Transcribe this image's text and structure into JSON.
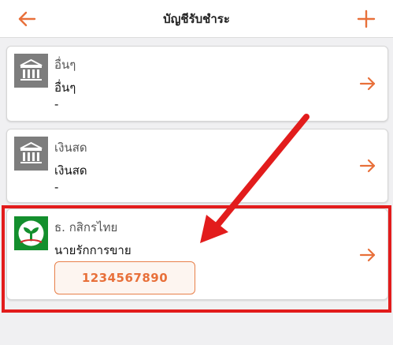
{
  "header": {
    "title": "บัญชีรับชำระ",
    "back_icon": "arrow-left-icon",
    "add_icon": "plus-icon"
  },
  "accounts": [
    {
      "bank_name": "อื่นๆ",
      "account_name": "อื่นๆ",
      "account_number": "-",
      "logo_icon": "bank-building-icon"
    },
    {
      "bank_name": "เงินสด",
      "account_name": "เงินสด",
      "account_number": "-",
      "logo_icon": "bank-building-icon"
    },
    {
      "bank_name": "ธ. กสิกรไทย",
      "account_name": "นายรักการขาย",
      "account_number": "1234567890",
      "logo_icon": "kasikorn-logo-icon"
    }
  ],
  "colors": {
    "accent": "#e8703a",
    "annotation": "#e21c1c",
    "kbank_green": "#138f2d"
  }
}
